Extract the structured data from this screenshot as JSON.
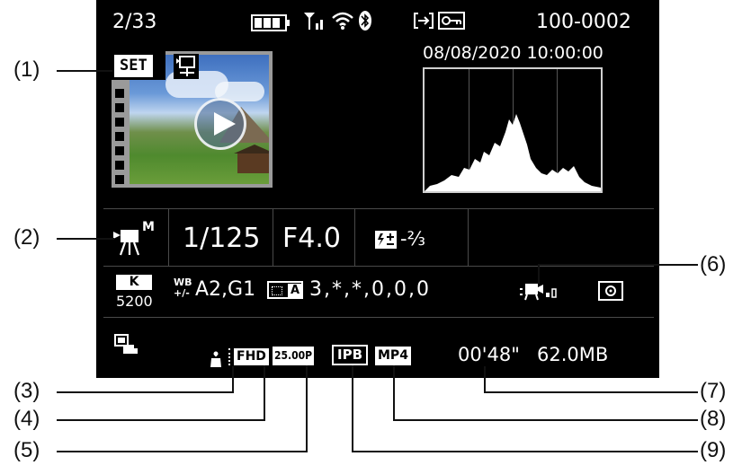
{
  "screen": {
    "frame_count": "2/33",
    "file_number": "100-0002",
    "datetime": "08/08/2020 10:00:00",
    "set_label": "SET",
    "shutter": "1/125",
    "aperture": "F4.0",
    "exposure_comp": "-⅔",
    "movie_mode_sup": "M",
    "k_label": "K",
    "color_temp": "5200",
    "wb_label": "WB",
    "wb_shift": "A2,G1",
    "picture_style_label": "A",
    "picture_style_values": "3,*,*,0,0,0",
    "fhd_label": "FHD",
    "frame_rate": "25.00P",
    "compression": "IPB",
    "format": "MP4",
    "duration": "00'48\"",
    "filesize": "62.0MB"
  },
  "callouts": [
    "(1)",
    "(2)",
    "(3)",
    "(4)",
    "(5)",
    "(6)",
    "(7)",
    "(8)",
    "(9)"
  ]
}
